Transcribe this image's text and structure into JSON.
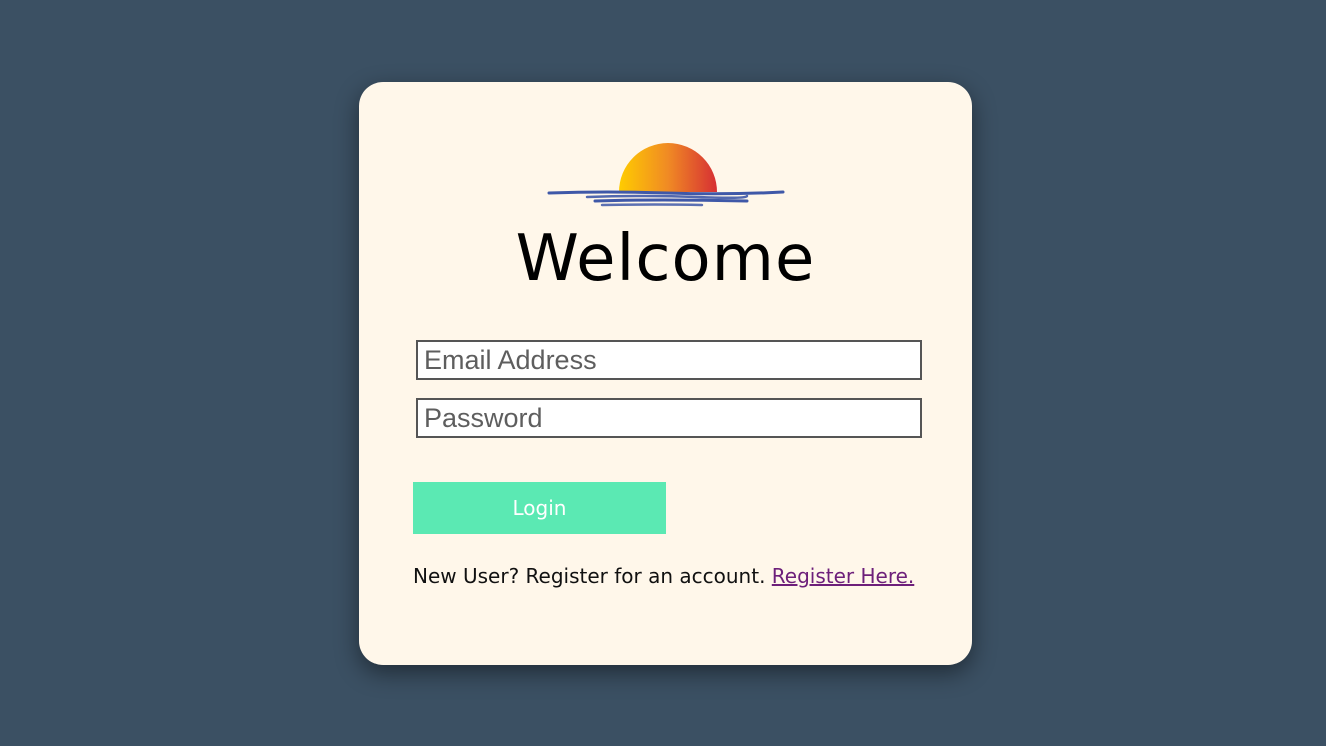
{
  "page": {
    "background_color": "#3b5063",
    "card_color": "#fff7ea"
  },
  "logo": {
    "icon": "sunset-icon",
    "sun_colors": [
      "#ffcc00",
      "#f08a24",
      "#d62f34"
    ],
    "water_color": "#3f58a8"
  },
  "login_form": {
    "title": "Welcome",
    "email_placeholder": "Email Address",
    "email_value": "",
    "password_placeholder": "Password",
    "password_value": "",
    "login_label": "Login",
    "login_color": "#5be9b3",
    "register_prompt": "New User? Register for an account.",
    "register_link_label": "Register Here.",
    "register_link_color": "#6d1f7a"
  }
}
